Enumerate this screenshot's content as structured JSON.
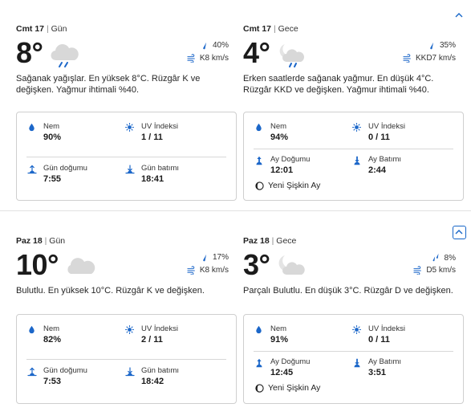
{
  "colors": {
    "accent": "#1766c8",
    "icon_blue": "#1c67c9",
    "cloud_grey": "#d8d8d8"
  },
  "day1": {
    "day": {
      "date": "Cmt 17",
      "period": "Gün",
      "temp": "8°",
      "icon": "rain-cloud-icon",
      "rain": "40%",
      "wind": "K8 km/s",
      "desc": "Sağanak yağışlar. En yüksek 8°C. Rüzgâr K ve değişken. Yağmur ihtimali %40.",
      "humidity_label": "Nem",
      "humidity": "90%",
      "uv_label": "UV İndeksi",
      "uv": "1 / 11",
      "rise_label": "Gün doğumu",
      "rise": "7:55",
      "set_label": "Gün batımı",
      "set": "18:41"
    },
    "night": {
      "date": "Cmt 17",
      "period": "Gece",
      "temp": "4°",
      "icon": "moon-rain-icon",
      "rain": "35%",
      "wind": "KKD7 km/s",
      "desc": "Erken saatlerde sağanak yağmur. En düşük 4°C. Rüzgâr KKD ve değişken. Yağmur ihtimali %40.",
      "humidity_label": "Nem",
      "humidity": "94%",
      "uv_label": "UV İndeksi",
      "uv": "0 / 11",
      "rise_label": "Ay Doğumu",
      "rise": "12:01",
      "set_label": "Ay Batımı",
      "set": "2:44",
      "moon_phase": "Yeni Şişkin Ay"
    }
  },
  "day2": {
    "day": {
      "date": "Paz 18",
      "period": "Gün",
      "temp": "10°",
      "icon": "cloud-icon",
      "rain": "17%",
      "wind": "K8 km/s",
      "desc": "Bulutlu. En yüksek 10°C. Rüzgâr K ve değişken.",
      "humidity_label": "Nem",
      "humidity": "82%",
      "uv_label": "UV İndeksi",
      "uv": "2 / 11",
      "rise_label": "Gün doğumu",
      "rise": "7:53",
      "set_label": "Gün batımı",
      "set": "18:42"
    },
    "night": {
      "date": "Paz 18",
      "period": "Gece",
      "temp": "3°",
      "icon": "moon-cloud-icon",
      "rain": "8%",
      "wind": "D5 km/s",
      "desc": "Parçalı Bulutlu. En düşük 3°C. Rüzgâr D ve değişken.",
      "humidity_label": "Nem",
      "humidity": "91%",
      "uv_label": "UV İndeksi",
      "uv": "0 / 11",
      "rise_label": "Ay Doğumu",
      "rise": "12:45",
      "set_label": "Ay Batımı",
      "set": "3:51",
      "moon_phase": "Yeni Şişkin Ay"
    }
  }
}
